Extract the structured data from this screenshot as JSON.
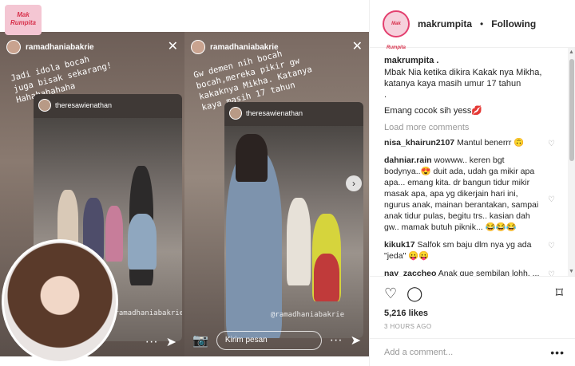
{
  "media": {
    "logo_text": "Mak Rumpita",
    "story1": {
      "user": "ramadhaniabakrie",
      "caption": "Jadi idola bocah\njuga bisak sekarang!\nHahahahahaha",
      "inner_user": "theresawienathan",
      "watermark": "@ramadhaniabakrie"
    },
    "story2": {
      "user": "ramadhaniabakrie",
      "caption": "Gw demen nih bocah\nbocah,mereka pikir gw\nkakaknya Mikha. Katanya\nkaya masih 17 tahun",
      "inner_user": "theresawienathan",
      "watermark": "@ramadhaniabakrie",
      "message_placeholder": "Kirim pesan"
    },
    "close_glyph": "✕",
    "next_glyph": "›",
    "camera_glyph": "📷",
    "send_glyph": "➤",
    "dots_glyph": "···"
  },
  "post": {
    "username": "makrumpita",
    "separator": "•",
    "follow_label": "Following",
    "avatar_text": "Mak Rumpita",
    "caption_user": "makrumpita .",
    "caption_lines": [
      "Mbak Nia ketika dikira Kakak nya Mikha,",
      "katanya kaya masih umur 17 tahun",
      "."
    ],
    "caption_tail": "Emang cocok sih yess💋",
    "load_more": "Load more comments",
    "comments": [
      {
        "user": "nisa_khairun2107",
        "text": "Mantul benerrr 🙃"
      },
      {
        "user": "dahniar.rain",
        "text": "wowww.. keren bgt bodynya..😍 duit ada, udah ga mikir apa apa... emang kita. dr bangun tidur mikir masak apa, apa yg dikerjain hari ini, ngurus anak, mainan berantakan, sampai anak tidur pulas, begitu trs.. kasian dah gw.. mamak butuh piknik... 😂😂😂"
      },
      {
        "user": "kikuk17",
        "text": "Salfok sm baju dlm nya yg ada \"jeda\" 😛😛"
      },
      {
        "user": "nay_zaccheo",
        "text": "Anak gue sembilan lohh, ... 😂😂😂"
      }
    ],
    "likes": "5,216 likes",
    "time": "3 HOURS AGO",
    "add_comment_placeholder": "Add a comment...",
    "more_glyph": "•••"
  },
  "icons": {
    "heart": "♡",
    "comment": "◯",
    "bookmark": "⌑",
    "scroll_up": "▲",
    "scroll_down": "▼"
  }
}
